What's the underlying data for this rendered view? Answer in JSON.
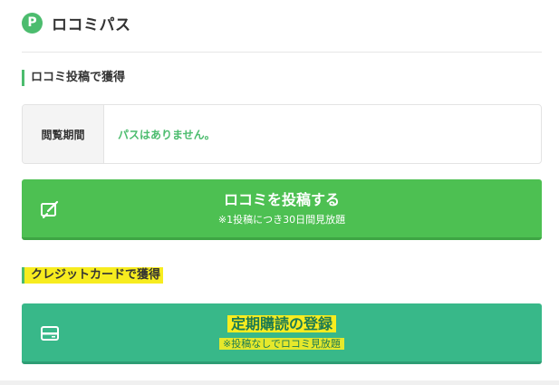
{
  "header": {
    "icon_letter": "P",
    "title": "ロコミパス"
  },
  "review_section": {
    "title": "ロコミ投稿で獲得",
    "period": {
      "label": "閲覧期間",
      "value": "パスはありません。"
    },
    "button": {
      "label": "ロコミを投稿する",
      "sublabel": "※1投稿につき30日間見放題",
      "icon": "edit-icon"
    }
  },
  "card_section": {
    "title": "クレジットカードで獲得",
    "button": {
      "label": "定期購読の登録",
      "sublabel": "※投稿なしでロコミ見放題",
      "icon": "credit-card-icon"
    }
  },
  "colors": {
    "accent_green": "#4dc052",
    "teal": "#38b889",
    "highlight": "#f7ec1f"
  }
}
